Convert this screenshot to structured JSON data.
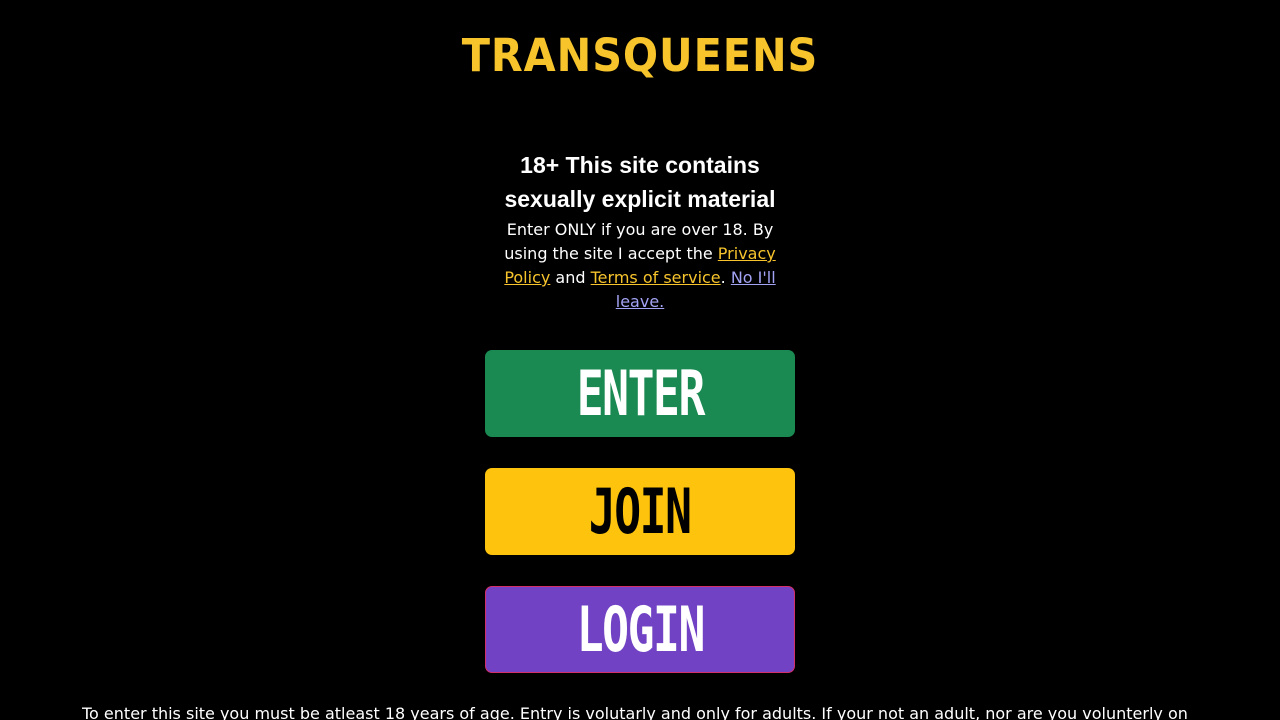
{
  "logo": {
    "text": "TRANSQUEENS"
  },
  "warning": {
    "title": "18+ This site contains sexually explicit material",
    "body_prefix": "Enter ONLY if you are over 18. By using the site I accept the ",
    "privacy_link": "Privacy Policy",
    "and_text": " and ",
    "terms_link": "Terms of service",
    "period": ". ",
    "leave_link": "No I'll leave."
  },
  "buttons": {
    "enter_label": "ENTER",
    "join_label": "JOIN",
    "login_label": "LOGIN"
  },
  "disclaimer": "To enter this site you must be atleast 18 years of age. Entry is volutarly and only for adults. If your not an adult, nor are you volunterly on",
  "colors": {
    "background": "#000000",
    "brand_yellow": "#f7c42c",
    "enter_green": "#1a8a52",
    "join_yellow": "#fec30c",
    "login_purple": "#7143c4",
    "leave_link_blue": "#a3a3f5"
  }
}
